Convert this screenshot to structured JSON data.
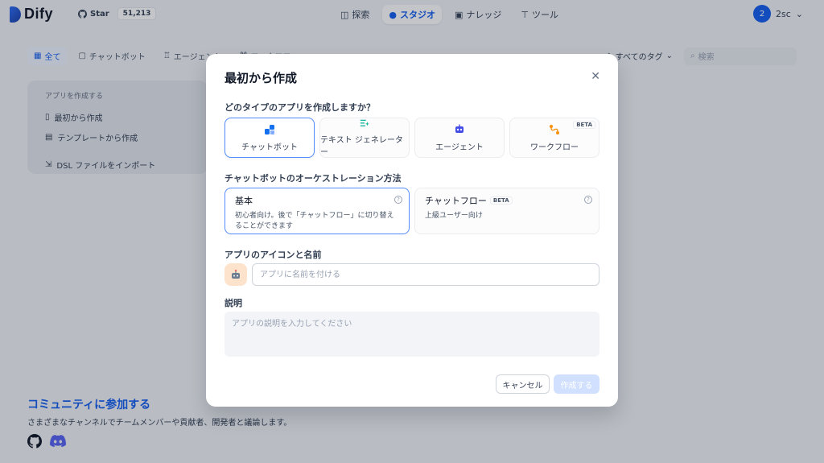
{
  "header": {
    "logo_text": "Dify",
    "github_label": "Star",
    "github_count": "51,213",
    "nav": [
      {
        "label": "探索"
      },
      {
        "label": "スタジオ"
      },
      {
        "label": "ナレッジ"
      },
      {
        "label": "ツール"
      }
    ],
    "user_initial": "2",
    "user_name": "2sc"
  },
  "tabs": [
    {
      "label": "全て"
    },
    {
      "label": "チャットボット"
    },
    {
      "label": "エージェント"
    },
    {
      "label": "ワークフロー"
    }
  ],
  "filters": {
    "tag_label": "すべてのタグ",
    "search_placeholder": "検索"
  },
  "create_card": {
    "title": "アプリを作成する",
    "blank": "最初から作成",
    "template": "テンプレートから作成",
    "import": "DSL ファイルをインポート"
  },
  "community": {
    "title": "コミュニティに参加する",
    "desc": "さまざまなチャンネルでチームメンバーや貢献者、開発者と議論します。"
  },
  "modal": {
    "title": "最初から作成",
    "type_question": "どのタイプのアプリを作成しますか？",
    "types": [
      {
        "label": "チャットボット",
        "icon": "chatbot-icon",
        "color": "#1570ef"
      },
      {
        "label": "テキスト ジェネレーター",
        "icon": "text-generator-icon",
        "color": "#15b79e"
      },
      {
        "label": "エージェント",
        "icon": "agent-icon",
        "color": "#444ce7"
      },
      {
        "label": "ワークフロー",
        "icon": "workflow-icon",
        "color": "#f79009",
        "badge": "BETA"
      }
    ],
    "orchestration_label": "チャットボットのオーケストレーション方法",
    "modes": [
      {
        "title": "基本",
        "desc": "初心者向け。後で「チャットフロー」に切り替えることができます"
      },
      {
        "title": "チャットフロー",
        "badge": "BETA",
        "desc": "上級ユーザー向け"
      }
    ],
    "icon_name_label": "アプリのアイコンと名前",
    "name_placeholder": "アプリに名前を付ける",
    "desc_label": "説明",
    "desc_placeholder": "アプリの説明を入力してください",
    "cancel": "キャンセル",
    "create": "作成する"
  },
  "colors": {
    "accent": "#155eef",
    "selected_border": "#528bff"
  }
}
